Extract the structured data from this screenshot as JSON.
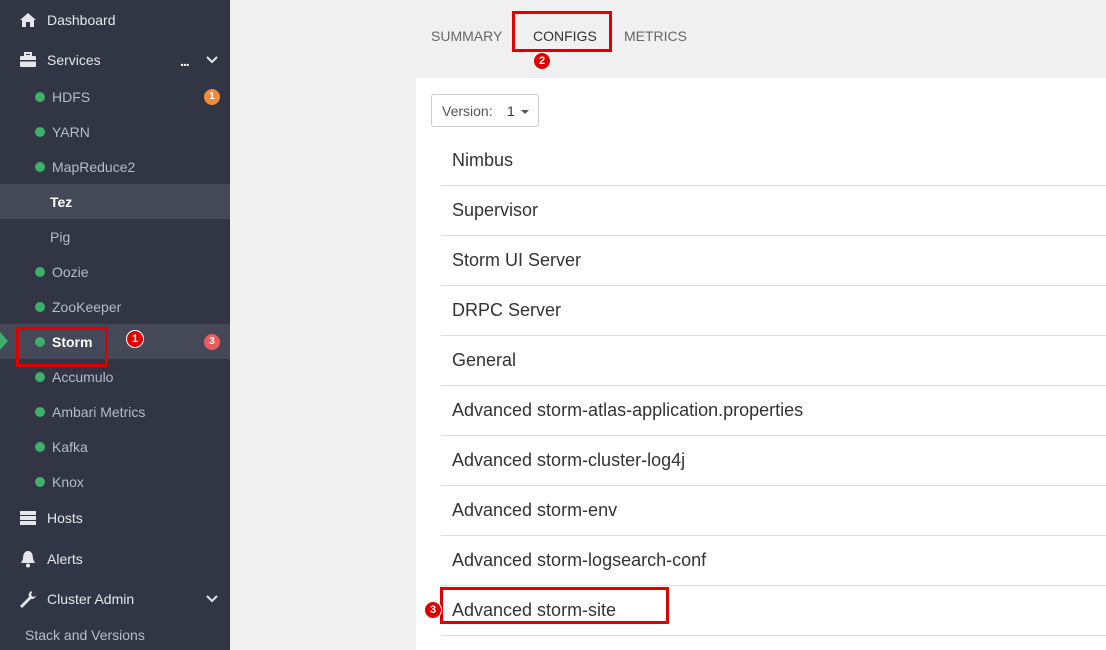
{
  "sidebar": {
    "top_items": [
      {
        "label": "Dashboard",
        "icon": "home-icon"
      },
      {
        "label": "Services",
        "icon": "briefcase-icon"
      }
    ],
    "services": [
      {
        "label": "HDFS",
        "status": "green",
        "badge": "1",
        "badge_color": "#f08c3a"
      },
      {
        "label": "YARN",
        "status": "green"
      },
      {
        "label": "MapReduce2",
        "status": "green"
      },
      {
        "label": "Tez",
        "status": "none"
      },
      {
        "label": "Pig",
        "status": "none"
      },
      {
        "label": "Oozie",
        "status": "green"
      },
      {
        "label": "ZooKeeper",
        "status": "green"
      },
      {
        "label": "Storm",
        "status": "green",
        "badge": "3",
        "badge_color": "#e75d5d",
        "selected": true
      },
      {
        "label": "Accumulo",
        "status": "green"
      },
      {
        "label": "Ambari Metrics",
        "status": "green"
      },
      {
        "label": "Kafka",
        "status": "green"
      },
      {
        "label": "Knox",
        "status": "green"
      }
    ],
    "bottom_items": [
      {
        "label": "Hosts",
        "icon": "server-icon"
      },
      {
        "label": "Alerts",
        "icon": "bell-icon"
      },
      {
        "label": "Cluster Admin",
        "icon": "wrench-icon"
      }
    ],
    "stack_versions": "Stack and Versions"
  },
  "tabs": [
    "SUMMARY",
    "CONFIGS",
    "METRICS"
  ],
  "version": {
    "label": "Version:",
    "value": "1"
  },
  "config_sections": [
    "Nimbus",
    "Supervisor",
    "Storm UI Server",
    "DRPC Server",
    "General",
    "Advanced storm-atlas-application.properties",
    "Advanced storm-cluster-log4j",
    "Advanced storm-env",
    "Advanced storm-logsearch-conf",
    "Advanced storm-site"
  ],
  "annotations": [
    "1",
    "2",
    "3"
  ],
  "colors": {
    "sidebar_bg": "#323544",
    "status_green": "#3fb06b",
    "annotation_red": "#e00000"
  }
}
